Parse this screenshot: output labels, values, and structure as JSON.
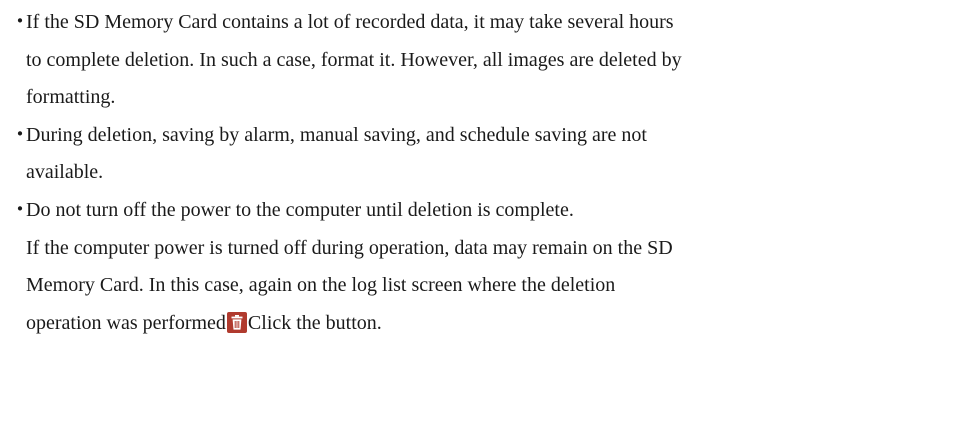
{
  "notes": [
    {
      "bullet": "・",
      "lines": [
        "If  the SD Memory Card contains a lot of recorded data, it may take several hours",
        "to complete deletion. In such a case, format it. However, all images are deleted by",
        "formatting."
      ]
    },
    {
      "bullet": "・",
      "lines": [
        "During deletion, saving by alarm, manual saving, and schedule saving are not",
        "available."
      ]
    },
    {
      "bullet": "・",
      "lines": [
        "Do  not turn off the power to the computer until deletion is complete.",
        "If the computer power is turned off during operation, data may remain on the SD",
        "Memory Card. In this case, again on the log list screen where the deletion"
      ],
      "last_line_before_icon": "operation was performed",
      "last_line_after_icon": "Click the button.",
      "inline_icon": "trash-icon",
      "icon_bg_color": "#b03a2e"
    }
  ]
}
